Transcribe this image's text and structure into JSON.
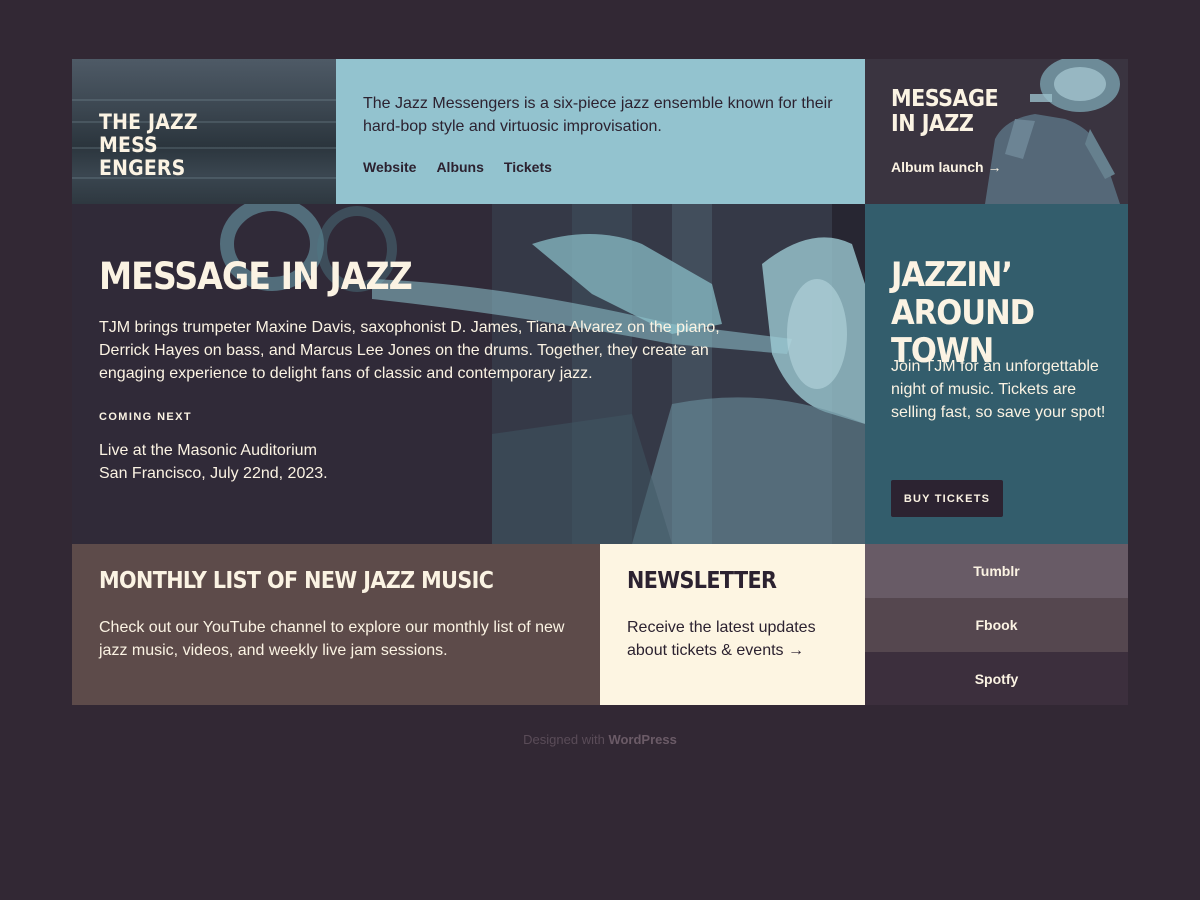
{
  "site": {
    "logo_text": "THE JAZZ\nMESS\nENGERS"
  },
  "intro": {
    "text": "The Jazz Messengers is a six-piece jazz ensemble known for their hard-bop style and virtuosic improvisation.",
    "nav": [
      {
        "label": "Website"
      },
      {
        "label": "Albuns"
      },
      {
        "label": "Tickets"
      }
    ]
  },
  "promo": {
    "title": "MESSAGE\nIN JAZZ",
    "link": "Album launch →"
  },
  "hero": {
    "title": "MESSAGE IN JAZZ",
    "text": "TJM brings trumpeter Maxine Davis, saxophonist D. James, Tiana Alvarez on the piano, Derrick Hayes on bass, and Marcus Lee Jones on the drums. Together, they create an engaging experience to delight fans of classic and contemporary jazz.",
    "coming_label": "COMING NEXT",
    "event_line1": "Live at the Masonic Auditorium",
    "event_line2": "San Francisco, July 22nd, 2023."
  },
  "tickets": {
    "title": "JAZZIN’\nAROUND TOWN",
    "text": "Join TJM for an unforgettable night of music. Tickets are selling fast, so save your spot!",
    "button": "BUY TICKETS"
  },
  "monthly": {
    "title": "MONTHLY LIST OF NEW JAZZ MUSIC",
    "text": "Check out our YouTube channel to explore our monthly list of new jazz music, videos, and weekly live jam sessions."
  },
  "newsletter": {
    "title": "NEWSLETTER",
    "text": "Receive the latest updates about tickets & events →"
  },
  "social": [
    {
      "label": "Tumblr",
      "color": "#685b66"
    },
    {
      "label": "Fbook",
      "color": "#55474f"
    },
    {
      "label": "Spotfy",
      "color": "#3c2f3d"
    }
  ],
  "footer": {
    "prefix": "Designed with ",
    "brand": "WordPress"
  },
  "colors": {
    "background": "#322834",
    "intro_bg": "#93c3cf",
    "tickets_bg": "#335d6c",
    "monthly_bg": "#5d4b4a",
    "newsletter_bg": "#fdf5e2",
    "text_light": "#fbf3e3",
    "text_dark": "#2c2230",
    "image_tint": "#8fc4cf"
  },
  "images": {
    "logo_bg": "sea-waves-photo",
    "promo_bg": "trumpet-player-photo",
    "hero_bg": "trumpeter-closeup-photo"
  }
}
